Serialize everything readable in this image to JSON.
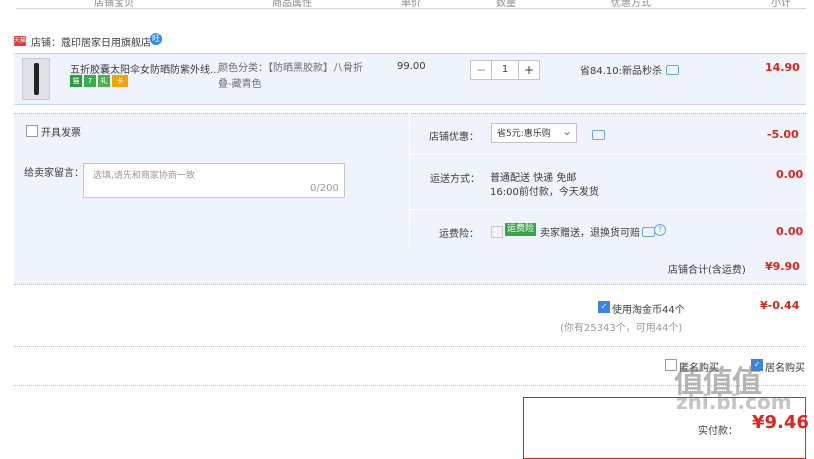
{
  "table_header": {
    "shop_info": "店铺宝贝",
    "attributes": "商品属性",
    "unit_price": "单价",
    "quantity": "数量",
    "discount": "优惠方式",
    "subtotal": "小计"
  },
  "shop": {
    "tag": "天猫",
    "label": "店铺：蔻印居家日用旗舰店",
    "badge": "旺"
  },
  "item": {
    "title": "五折胶囊太阳伞女防晒防紫外线...",
    "icons": [
      {
        "name": "tmall-icon",
        "text": "猫",
        "color": "#2a9d3c"
      },
      {
        "name": "seven-day-icon",
        "text": "7",
        "color": "#35b04a"
      },
      {
        "name": "gift-icon",
        "text": "礼",
        "color": "#4bb24a"
      },
      {
        "name": "card-icon",
        "text": "卡",
        "color": "#f4a300"
      }
    ],
    "attr_line1": "颜色分类：【防晒黑胶款】八骨折",
    "attr_line2": "叠-藏青色",
    "price": "99.00",
    "qty_minus": "−",
    "qty_value": "1",
    "qty_plus": "+",
    "discount_text": "省84.10:新品秒杀",
    "subtotal": "14.90"
  },
  "options": {
    "invoice_label": "开具发票",
    "memo_label": "给卖家留言：",
    "memo_placeholder": "选填,请先和商家协商一致",
    "memo_count": "0/200",
    "shop_discount_label": "店铺优惠：",
    "shop_discount_select": "省5元:惠乐购",
    "shop_discount_value": "-5.00",
    "shipping_label": "运送方式：",
    "shipping_line1": "普通配送 快递 免邮",
    "shipping_line2": "16:00前付款，今天发货",
    "shipping_value": "0.00",
    "insurance_label": "运费险：",
    "insurance_badge": "运费险",
    "insurance_text": "卖家赠送，退换货可赔",
    "insurance_value": "0.00"
  },
  "shop_total": {
    "label": "店铺合计(含运费)",
    "value": "¥9.90"
  },
  "coins": {
    "label": "使用淘金币44个",
    "value": "¥-0.44",
    "note": "(你有25343个，可用44个)"
  },
  "bottom_options": {
    "opt1": "匿名购买",
    "opt2": "居名购买"
  },
  "final": {
    "label": "实付款：",
    "value": "¥9.46"
  },
  "watermark": {
    "line1": "值值值",
    "line2": "zhi.bi.com"
  }
}
